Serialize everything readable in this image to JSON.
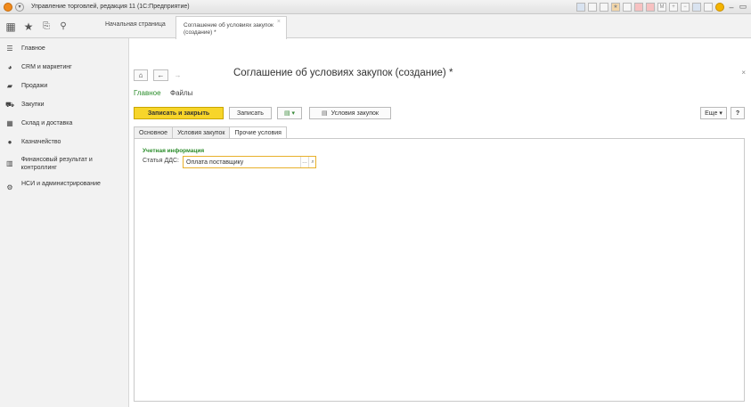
{
  "window": {
    "title": "Управление торговлей, редакция 11 (1С:Предприятие)"
  },
  "topbar": {
    "home_tab": "Начальная страница",
    "active_tab": "Соглашение об условиях закупок (создание) *",
    "active_tab_close": "×"
  },
  "sidebar": {
    "items": [
      {
        "label": "Главное",
        "icon": "menu-lines-icon"
      },
      {
        "label": "CRM и маркетинг",
        "icon": "crm-icon"
      },
      {
        "label": "Продажи",
        "icon": "sales-bag-icon"
      },
      {
        "label": "Закупки",
        "icon": "cart-icon"
      },
      {
        "label": "Склад и доставка",
        "icon": "warehouse-icon"
      },
      {
        "label": "Казначейство",
        "icon": "treasury-icon"
      },
      {
        "label": "Финансовый результат и контроллинг",
        "icon": "chart-icon"
      },
      {
        "label": "НСИ и администрирование",
        "icon": "gear-icon"
      }
    ]
  },
  "document": {
    "title": "Соглашение об условиях закупок (создание) *",
    "close": "×",
    "nav_main": "Главное",
    "nav_files": "Файлы"
  },
  "toolbar": {
    "save_close": "Записать и закрыть",
    "save": "Записать",
    "terms": "Условия закупок",
    "more": "Еще",
    "help": "?"
  },
  "tabs": [
    "Основное",
    "Условия закупок",
    "Прочие условия"
  ],
  "form": {
    "group_title": "Учетная информация",
    "dds_label": "Статья ДДС:",
    "dds_value": "Оплата поставщику"
  },
  "colors": {
    "accent_yellow": "#f7d52a",
    "green_link": "#2a8c2a"
  }
}
